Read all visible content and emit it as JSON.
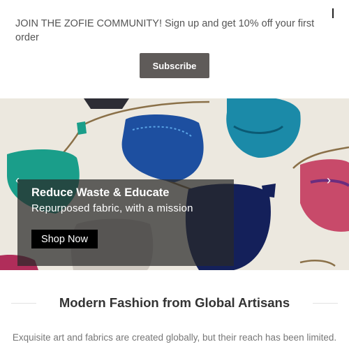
{
  "banner": {
    "message": "JOIN THE ZOFIE COMMUNITY! Sign up and get 10% off your first order",
    "subscribe_label": "Subscribe"
  },
  "hero": {
    "title": "Reduce Waste & Educate",
    "subtitle": "Repurposed fabric, with a mission",
    "cta_label": "Shop Now",
    "prev_icon": "chevron-left-icon",
    "next_icon": "chevron-right-icon"
  },
  "section": {
    "heading": "Modern Fashion from Global Artisans",
    "description": "Exquisite art and fabrics are created globally, but their reach has been limited."
  },
  "colors": {
    "subscribe_bg": "#5f5b59",
    "overlay_bg": "rgba(40,40,40,0.72)",
    "cta_bg": "#000000",
    "heading": "#333333",
    "body_text": "#777777"
  }
}
